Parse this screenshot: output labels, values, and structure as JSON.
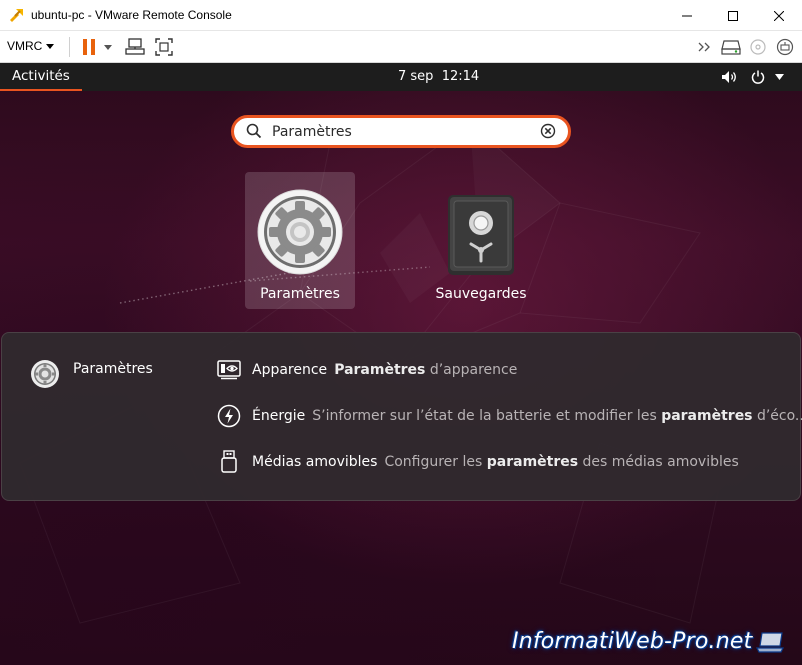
{
  "window": {
    "title": "ubuntu-pc - VMware Remote Console"
  },
  "toolbar": {
    "vmrc_label": "VMRC"
  },
  "topbar": {
    "activities_label": "Activités",
    "date": "7 sep",
    "time": "12:14"
  },
  "search": {
    "value": "Paramètres",
    "placeholder": ""
  },
  "apps": [
    {
      "label": "Paramètres",
      "icon": "settings-gear-icon",
      "selected": true
    },
    {
      "label": "Sauvegardes",
      "icon": "backup-safe-icon",
      "selected": false
    }
  ],
  "provider": {
    "name": "Paramètres",
    "results": [
      {
        "title": "Apparence",
        "desc_bold": "Paramètres",
        "desc_rest": " d’apparence",
        "icon": "appearance-icon"
      },
      {
        "title": "Énergie",
        "desc_pre": "S’informer sur l’état de la batterie et modifier les ",
        "desc_bold": "paramètres",
        "desc_rest": " d’éco...",
        "icon": "power-icon"
      },
      {
        "title": "Médias amovibles",
        "desc_pre": "Configurer les ",
        "desc_bold": "paramètres",
        "desc_rest": " des médias amovibles",
        "icon": "usb-drive-icon"
      }
    ]
  },
  "watermark": {
    "text": "InformatiWeb-Pro.net"
  },
  "colors": {
    "ubuntu_orange": "#e95420",
    "topbar": "#1d1d1d",
    "panel": "#302a2e"
  }
}
